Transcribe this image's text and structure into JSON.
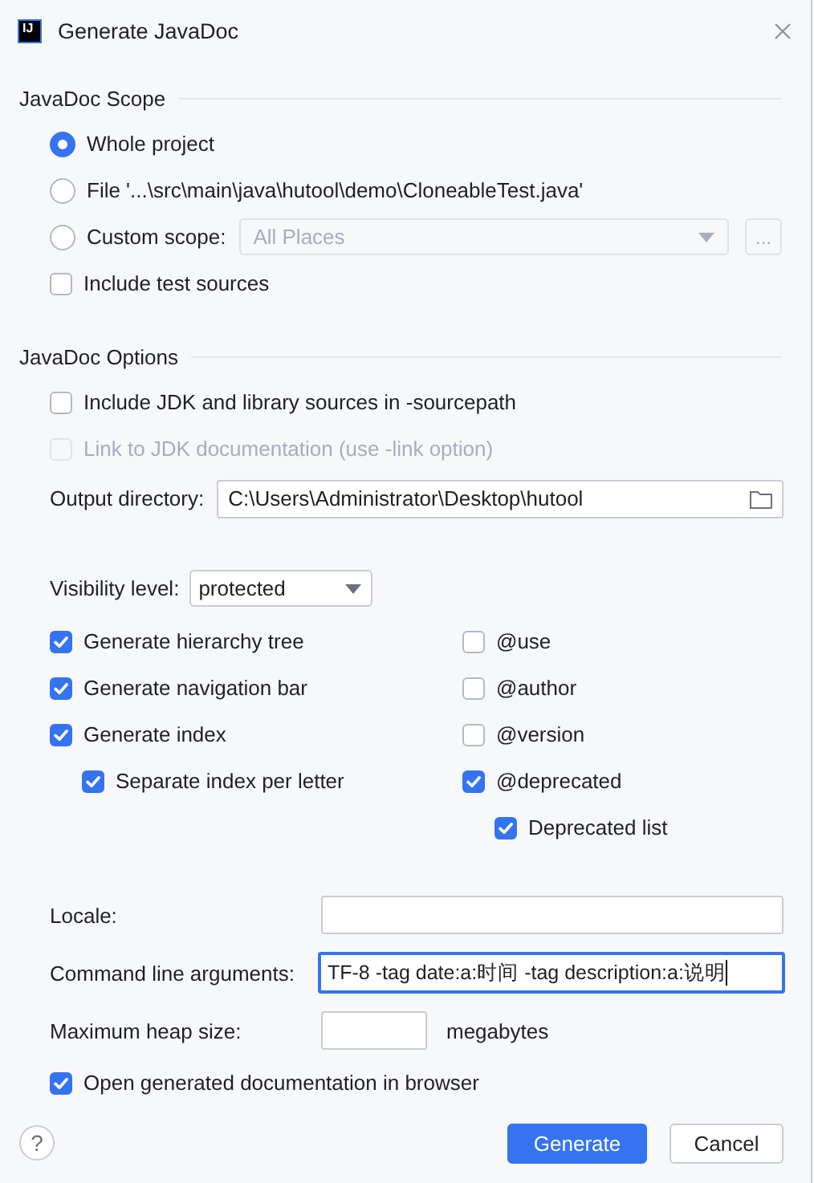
{
  "window": {
    "logo": "IJ",
    "title": "Generate JavaDoc"
  },
  "scope": {
    "heading": "JavaDoc Scope",
    "options": [
      {
        "kind": "radio",
        "label": "Whole project",
        "selected": true
      },
      {
        "kind": "radio",
        "label": "File '...\\src\\main\\java\\hutool\\demo\\CloneableTest.java'",
        "selected": false
      },
      {
        "kind": "radio-combo",
        "label": "Custom scope:",
        "selected": false,
        "combo": {
          "value": "All Places",
          "disabled": true
        },
        "browse": "..."
      }
    ],
    "include_test": {
      "label": "Include test sources",
      "checked": false
    }
  },
  "options": {
    "heading": "JavaDoc Options",
    "include_jdk": {
      "label": "Include JDK and library sources in -sourcepath",
      "checked": false
    },
    "link_jdk": {
      "label": "Link to JDK documentation (use -link option)",
      "checked": false,
      "disabled": true
    },
    "output_directory": {
      "label": "Output directory:",
      "value": "C:\\Users\\Administrator\\Desktop\\hutool"
    },
    "visibility": {
      "label": "Visibility level:",
      "value": "protected"
    },
    "left_checks": [
      {
        "label": "Generate hierarchy tree",
        "checked": true
      },
      {
        "label": "Generate navigation bar",
        "checked": true
      },
      {
        "label": "Generate index",
        "checked": true,
        "children": [
          {
            "label": "Separate index per letter",
            "checked": true
          }
        ]
      }
    ],
    "right_checks": [
      {
        "label": "@use",
        "checked": false
      },
      {
        "label": "@author",
        "checked": false
      },
      {
        "label": "@version",
        "checked": false
      },
      {
        "label": "@deprecated",
        "checked": true,
        "children": [
          {
            "label": "Deprecated list",
            "checked": true
          }
        ]
      }
    ]
  },
  "locale": {
    "label": "Locale:"
  },
  "command_line": {
    "label": "Command line arguments:",
    "value": "TF-8 -tag date:a:时间 -tag description:a:说明",
    "focused": true
  },
  "max_heap": {
    "label": "Maximum heap size:",
    "unit": "megabytes"
  },
  "open_browser": {
    "label": "Open generated documentation in browser",
    "checked": true
  },
  "help": "?",
  "buttons": [
    {
      "label": "Generate",
      "primary": true
    },
    {
      "label": "Cancel",
      "primary": false
    }
  ]
}
